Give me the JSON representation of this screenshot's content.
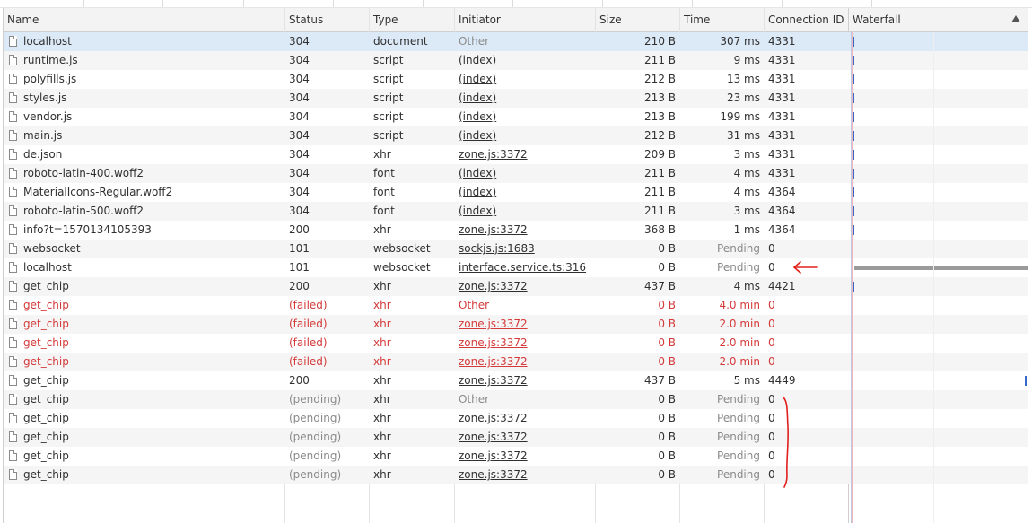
{
  "columns": [
    "Name",
    "Status",
    "Type",
    "Initiator",
    "Size",
    "Time",
    "Connection ID",
    "Waterfall"
  ],
  "colors": {
    "failed": "#d43a3a",
    "selected_row": "#dce9f7",
    "waterfall_bar": "#3568c8",
    "annotation": "#e0201c"
  },
  "rows": [
    {
      "name": "localhost",
      "status": "304",
      "type": "document",
      "initiator": "Other",
      "size": "210 B",
      "time": "307 ms",
      "conn": "4331",
      "state": "normal"
    },
    {
      "name": "runtime.js",
      "status": "304",
      "type": "script",
      "initiator": "(index)",
      "size": "211 B",
      "time": "9 ms",
      "conn": "4331",
      "state": "normal"
    },
    {
      "name": "polyfills.js",
      "status": "304",
      "type": "script",
      "initiator": "(index)",
      "size": "212 B",
      "time": "13 ms",
      "conn": "4331",
      "state": "normal"
    },
    {
      "name": "styles.js",
      "status": "304",
      "type": "script",
      "initiator": "(index)",
      "size": "213 B",
      "time": "23 ms",
      "conn": "4331",
      "state": "normal"
    },
    {
      "name": "vendor.js",
      "status": "304",
      "type": "script",
      "initiator": "(index)",
      "size": "213 B",
      "time": "199 ms",
      "conn": "4331",
      "state": "normal"
    },
    {
      "name": "main.js",
      "status": "304",
      "type": "script",
      "initiator": "(index)",
      "size": "212 B",
      "time": "31 ms",
      "conn": "4331",
      "state": "normal"
    },
    {
      "name": "de.json",
      "status": "304",
      "type": "xhr",
      "initiator": "zone.js:3372",
      "size": "209 B",
      "time": "3 ms",
      "conn": "4331",
      "state": "normal"
    },
    {
      "name": "roboto-latin-400.woff2",
      "status": "304",
      "type": "font",
      "initiator": "(index)",
      "size": "211 B",
      "time": "4 ms",
      "conn": "4331",
      "state": "normal"
    },
    {
      "name": "MaterialIcons-Regular.woff2",
      "status": "304",
      "type": "font",
      "initiator": "(index)",
      "size": "211 B",
      "time": "4 ms",
      "conn": "4364",
      "state": "normal"
    },
    {
      "name": "roboto-latin-500.woff2",
      "status": "304",
      "type": "font",
      "initiator": "(index)",
      "size": "211 B",
      "time": "3 ms",
      "conn": "4364",
      "state": "normal"
    },
    {
      "name": "info?t=1570134105393",
      "status": "200",
      "type": "xhr",
      "initiator": "zone.js:3372",
      "size": "368 B",
      "time": "1 ms",
      "conn": "4364",
      "state": "normal"
    },
    {
      "name": "websocket",
      "status": "101",
      "type": "websocket",
      "initiator": "sockjs.js:1683",
      "size": "0 B",
      "time": "Pending",
      "conn": "0",
      "state": "pending-time"
    },
    {
      "name": "localhost",
      "status": "101",
      "type": "websocket",
      "initiator": "interface.service.ts:316",
      "size": "0 B",
      "time": "Pending",
      "conn": "0",
      "state": "pending-time"
    },
    {
      "name": "get_chip",
      "status": "200",
      "type": "xhr",
      "initiator": "zone.js:3372",
      "size": "437 B",
      "time": "4 ms",
      "conn": "4421",
      "state": "normal"
    },
    {
      "name": "get_chip",
      "status": "(failed)",
      "type": "xhr",
      "initiator": "Other",
      "size": "0 B",
      "time": "4.0 min",
      "conn": "0",
      "state": "failed"
    },
    {
      "name": "get_chip",
      "status": "(failed)",
      "type": "xhr",
      "initiator": "zone.js:3372",
      "size": "0 B",
      "time": "2.0 min",
      "conn": "0",
      "state": "failed"
    },
    {
      "name": "get_chip",
      "status": "(failed)",
      "type": "xhr",
      "initiator": "zone.js:3372",
      "size": "0 B",
      "time": "2.0 min",
      "conn": "0",
      "state": "failed"
    },
    {
      "name": "get_chip",
      "status": "(failed)",
      "type": "xhr",
      "initiator": "zone.js:3372",
      "size": "0 B",
      "time": "2.0 min",
      "conn": "0",
      "state": "failed"
    },
    {
      "name": "get_chip",
      "status": "200",
      "type": "xhr",
      "initiator": "zone.js:3372",
      "size": "437 B",
      "time": "5 ms",
      "conn": "4449",
      "state": "normal"
    },
    {
      "name": "get_chip",
      "status": "(pending)",
      "type": "xhr",
      "initiator": "Other",
      "size": "0 B",
      "time": "Pending",
      "conn": "0",
      "state": "pending"
    },
    {
      "name": "get_chip",
      "status": "(pending)",
      "type": "xhr",
      "initiator": "zone.js:3372",
      "size": "0 B",
      "time": "Pending",
      "conn": "0",
      "state": "pending"
    },
    {
      "name": "get_chip",
      "status": "(pending)",
      "type": "xhr",
      "initiator": "zone.js:3372",
      "size": "0 B",
      "time": "Pending",
      "conn": "0",
      "state": "pending"
    },
    {
      "name": "get_chip",
      "status": "(pending)",
      "type": "xhr",
      "initiator": "zone.js:3372",
      "size": "0 B",
      "time": "Pending",
      "conn": "0",
      "state": "pending"
    },
    {
      "name": "get_chip",
      "status": "(pending)",
      "type": "xhr",
      "initiator": "zone.js:3372",
      "size": "0 B",
      "time": "Pending",
      "conn": "0",
      "state": "pending"
    }
  ]
}
